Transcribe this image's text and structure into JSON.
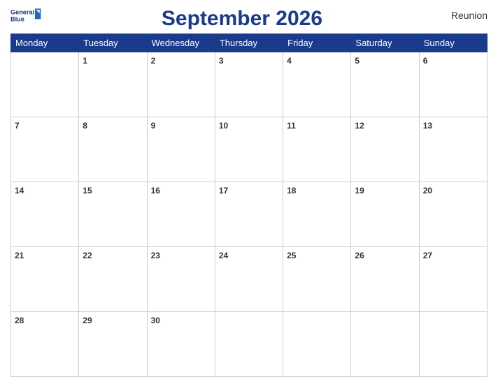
{
  "header": {
    "title": "September 2026",
    "region": "Reunion",
    "logo_line1": "General",
    "logo_line2": "Blue"
  },
  "weekdays": [
    "Monday",
    "Tuesday",
    "Wednesday",
    "Thursday",
    "Friday",
    "Saturday",
    "Sunday"
  ],
  "weeks": [
    [
      null,
      1,
      2,
      3,
      4,
      5,
      6
    ],
    [
      7,
      8,
      9,
      10,
      11,
      12,
      13
    ],
    [
      14,
      15,
      16,
      17,
      18,
      19,
      20
    ],
    [
      21,
      22,
      23,
      24,
      25,
      26,
      27
    ],
    [
      28,
      29,
      30,
      null,
      null,
      null,
      null
    ]
  ]
}
